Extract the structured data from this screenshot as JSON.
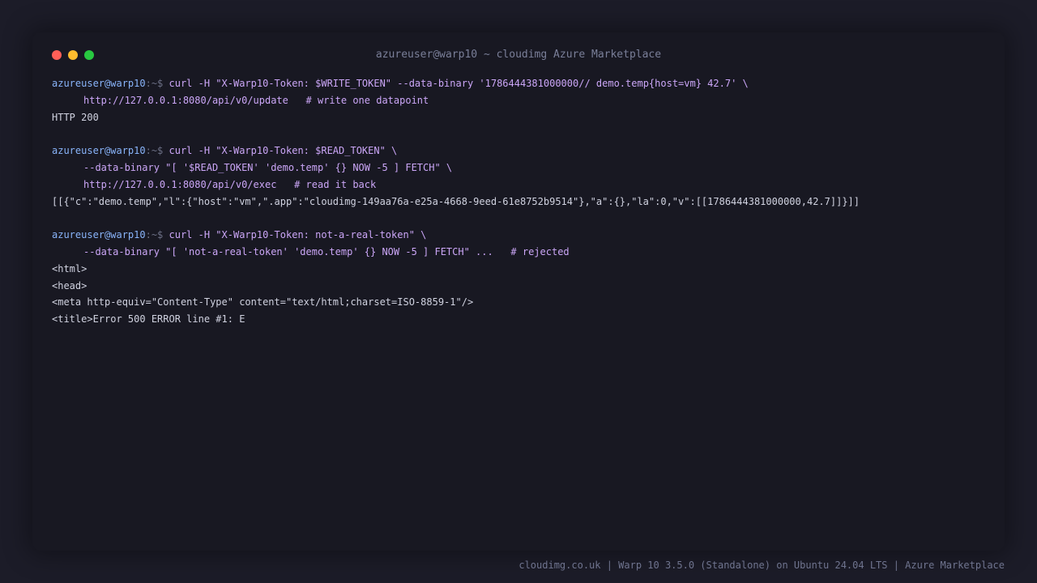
{
  "window": {
    "title": "azureuser@warp10 ~ cloudimg Azure Marketplace",
    "buttons": {
      "close_color": "#ff5f57",
      "minimize_color": "#febc2e",
      "maximize_color": "#28c840"
    }
  },
  "colors": {
    "background": "#1c1c28",
    "terminal_bg": "#181822",
    "user_color": "#89b4fa",
    "command_color": "#cba6f7",
    "output_color": "#d0d2e0"
  },
  "terminal": {
    "block1": {
      "user": "azureuser@warp10",
      "prompt": ":~$ ",
      "command": "curl -H \"X-Warp10-Token: $WRITE_TOKEN\" --data-binary '1786444381000000// demo.temp{host=vm} 42.7' \\",
      "cont1": "http://127.0.0.1:8080/api/v0/update   # write one datapoint",
      "output1": "HTTP 200"
    },
    "block2": {
      "user": "azureuser@warp10",
      "prompt": ":~$ ",
      "command": "curl -H \"X-Warp10-Token: $READ_TOKEN\" \\",
      "cont1": "--data-binary \"[ '$READ_TOKEN' 'demo.temp' {} NOW -5 ] FETCH\" \\",
      "cont2": "http://127.0.0.1:8080/api/v0/exec   # read it back",
      "output1": "[[{\"c\":\"demo.temp\",\"l\":{\"host\":\"vm\",\".app\":\"cloudimg-149aa76a-e25a-4668-9eed-61e8752b9514\"},\"a\":{},\"la\":0,\"v\":[[1786444381000000,42.7]]}]]"
    },
    "block3": {
      "user": "azureuser@warp10",
      "prompt": ":~$ ",
      "command": "curl -H \"X-Warp10-Token: not-a-real-token\" \\",
      "cont1": "--data-binary \"[ 'not-a-real-token' 'demo.temp' {} NOW -5 ] FETCH\" ...   # rejected",
      "output1": "<html>",
      "output2": "<head>",
      "output3": "<meta http-equiv=\"Content-Type\" content=\"text/html;charset=ISO-8859-1\"/>",
      "output4": "<title>Error 500 ERROR line #1: E"
    }
  },
  "footer": {
    "text": "cloudimg.co.uk | Warp 10 3.5.0 (Standalone) on Ubuntu 24.04 LTS | Azure Marketplace"
  }
}
